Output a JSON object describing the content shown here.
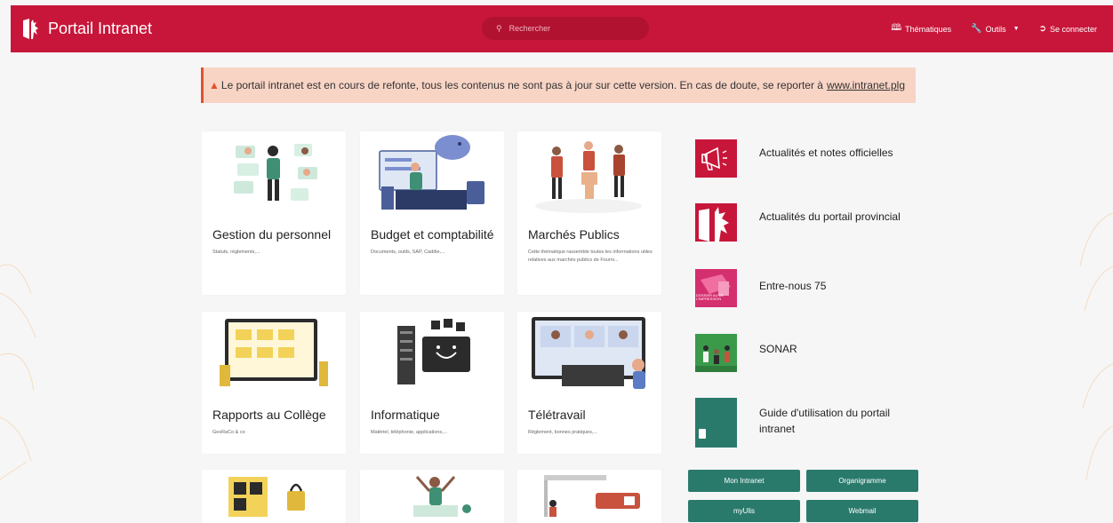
{
  "header": {
    "brand_title": "Portail Intranet",
    "search_placeholder": "Rechercher",
    "nav": [
      {
        "label": "Thématiques",
        "icon": "book-icon"
      },
      {
        "label": "Outils",
        "icon": "wrench-icon"
      },
      {
        "label": "Se connecter",
        "icon": "login-icon"
      }
    ]
  },
  "alert": {
    "icon": "warning-icon",
    "text": "Le portail intranet est en cours de refonte, tous les contenus ne sont pas à jour sur cette version. En cas de doute, se reporter à",
    "link": "www.intranet.plg"
  },
  "cards": [
    {
      "title": "Gestion du personnel",
      "desc": "Statuts, règlements,..."
    },
    {
      "title": "Budget et comptabilité",
      "desc": "Documents, outils, SAP, Caddie,..."
    },
    {
      "title": "Marchés Publics",
      "desc": "Cette thématique rassemble toutes les informations utiles relatives aux marchés publics de Fourni..."
    },
    {
      "title": "Rapports au Collège",
      "desc": "GesRaCo & co"
    },
    {
      "title": "Informatique",
      "desc": "Matériel, téléphonie, applications,..."
    },
    {
      "title": "Télétravail",
      "desc": "Règlement, bonnes pratiques,..."
    }
  ],
  "links": [
    {
      "label": "Actualités et notes officielles",
      "icon": "megaphone-icon"
    },
    {
      "label": "Actualités du portail provincial",
      "icon": "province-logo-icon"
    },
    {
      "label": "Entre-nous 75",
      "thumb_text": "DOSSIER AU DE L'IMPRESSION"
    },
    {
      "label": "SONAR",
      "icon": "group-meeting-icon"
    },
    {
      "label": "Guide d'utilisation du portail intranet",
      "icon": "document-icon"
    }
  ],
  "quick_buttons": [
    "Mon Intranet",
    "Organigramme",
    "myUlis",
    "Webmail"
  ],
  "colors": {
    "brand_red": "#c8163a",
    "teal": "#2a7a6c",
    "alert_bg": "#f8d4c5"
  }
}
